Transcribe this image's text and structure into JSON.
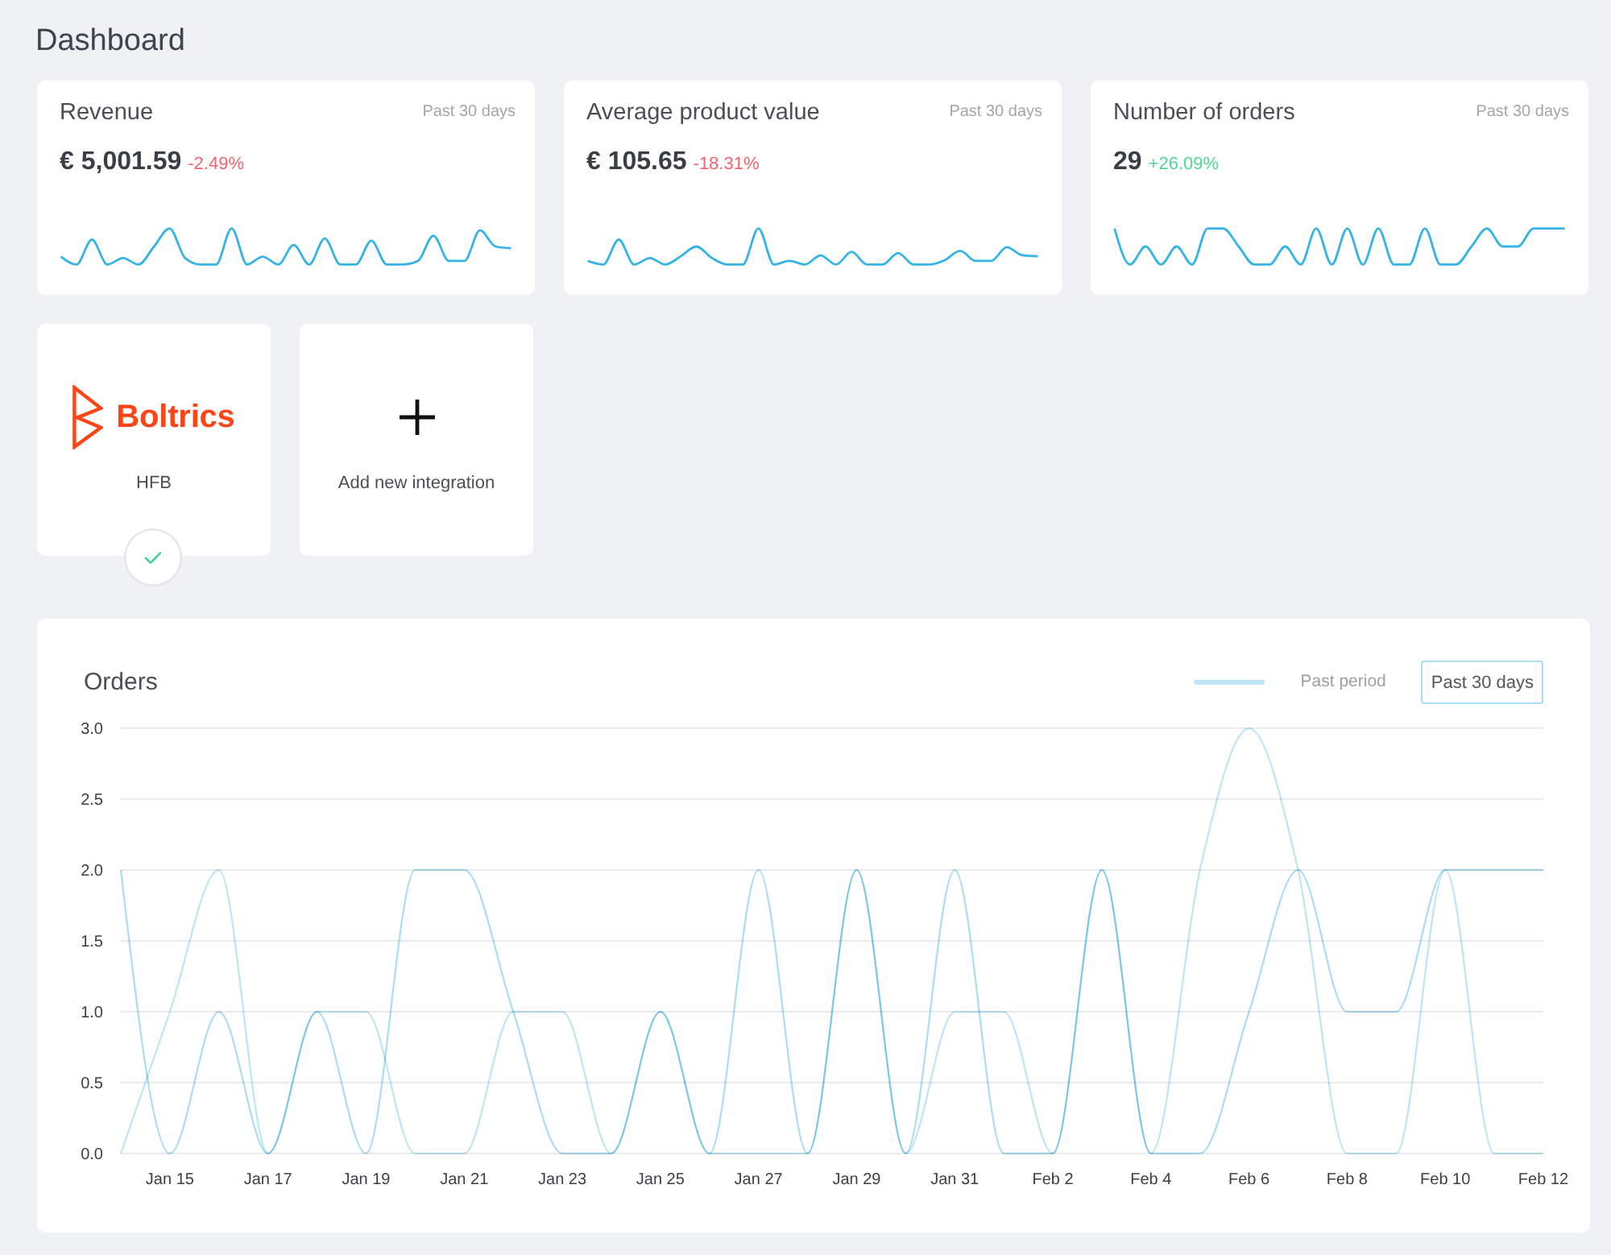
{
  "page_title": "Dashboard",
  "metric_cards": [
    {
      "title": "Revenue",
      "period": "Past 30 days",
      "value": "€ 5,001.59",
      "change": "-2.49%",
      "color": "#f4646e"
    },
    {
      "title": "Average product value",
      "period": "Past 30 days",
      "value": "€ 105.65",
      "change": "-18.31%",
      "color": "#f4646e"
    },
    {
      "title": "Number of orders",
      "period": "Past 30 days",
      "value": "29",
      "change": "+26.09%",
      "color": "#4ed894"
    }
  ],
  "integrations": [
    {
      "kind": "integration",
      "logo_text": "Boltrics",
      "name": "HFB",
      "connected": true
    },
    {
      "kind": "add",
      "label": "Add new integration"
    }
  ],
  "orders_chart": {
    "title": "Orders",
    "chart_data": {
      "type": "line",
      "grid": true,
      "categories": [
        null,
        "Jan 15",
        null,
        "Jan 17",
        null,
        "Jan 19",
        null,
        "Jan 21",
        null,
        "Jan 23",
        null,
        "Jan 25",
        null,
        "Jan 27",
        null,
        "Jan 29",
        null,
        "Jan 31",
        null,
        "Feb 2",
        null,
        "Feb 4",
        null,
        "Feb 6",
        null,
        "Feb 8",
        null,
        "Feb 10",
        null,
        "Feb 12"
      ],
      "ylim": [
        0,
        3
      ],
      "yticks": [
        {
          "value": 0,
          "label": "0.0"
        },
        {
          "value": 0.5,
          "label": "0.5"
        },
        {
          "value": 1,
          "label": "1.0"
        },
        {
          "value": 1.5,
          "label": "1.5"
        },
        {
          "value": 2,
          "label": "2.0"
        },
        {
          "value": 2.5,
          "label": "2.5"
        },
        {
          "value": 3,
          "label": "3.0"
        }
      ],
      "series": [
        {
          "name": "Past 30 days",
          "color": "#a9ddf1",
          "values": [
            2,
            0,
            1,
            0,
            1,
            0,
            2,
            2,
            1,
            0,
            0,
            1,
            0,
            2,
            0,
            2,
            0,
            2,
            0,
            0,
            2,
            0,
            0,
            1,
            2,
            1,
            1,
            2,
            2,
            2
          ]
        },
        {
          "name": "Past period",
          "color": "#bde5f5",
          "values": [
            0,
            1,
            2,
            0,
            1,
            1,
            0,
            0,
            1,
            1,
            0,
            1,
            0,
            0,
            0,
            2,
            0,
            1,
            1,
            0,
            2,
            0,
            2,
            3,
            2,
            0,
            0,
            2,
            0,
            0
          ]
        }
      ]
    }
  }
}
